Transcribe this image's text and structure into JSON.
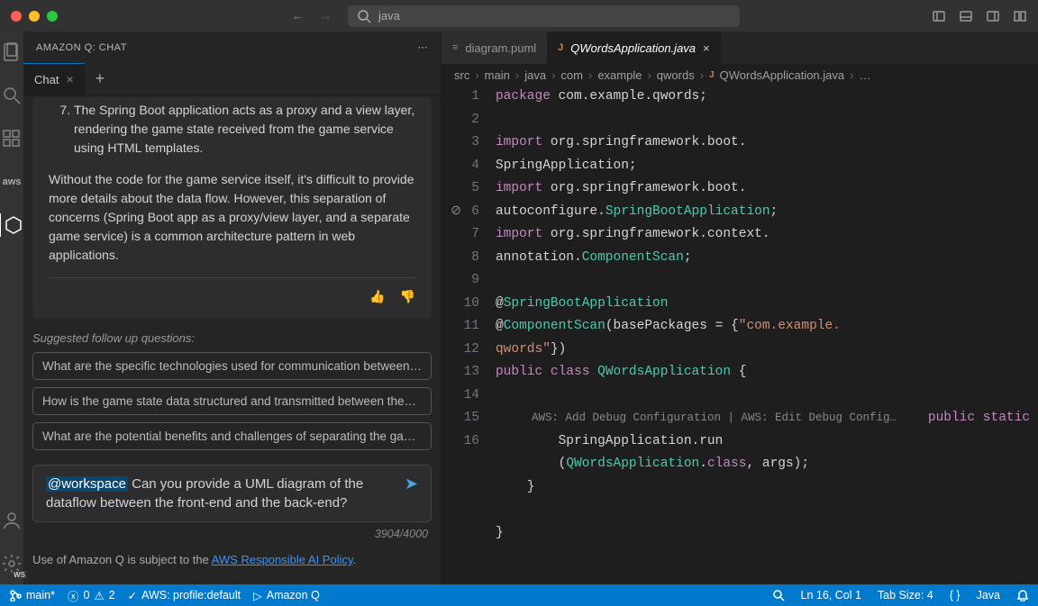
{
  "titlebar": {
    "search_value": "java"
  },
  "chat": {
    "header": "AMAZON Q: CHAT",
    "tab_label": "Chat",
    "list_item_num": "7.",
    "list_item_text": "The Spring Boot application acts as a proxy and a view layer, rendering the game state received from the game service using HTML templates.",
    "paragraph": "Without the code for the game service itself, it's difficult to provide more details about the data flow. However, this separation of concerns (Spring Boot app as a proxy/view layer, and a separate game service) is a common architecture pattern in web applications.",
    "suggested_label": "Suggested follow up questions:",
    "suggestions": [
      "What are the specific technologies used for communication between…",
      "How is the game state data structured and transmitted between the…",
      "What are the potential benefits and challenges of separating the ga…"
    ],
    "input_mention": "@workspace",
    "input_rest": " Can you provide a UML diagram of the dataflow between the front-end and the back-end?",
    "char_count": "3904/4000",
    "policy_prefix": "Use of Amazon Q is subject to the ",
    "policy_link": "AWS Responsible AI Policy",
    "policy_suffix": "."
  },
  "editor": {
    "tabs": [
      {
        "icon": "≡",
        "name": "diagram.puml",
        "active": false
      },
      {
        "icon": "J",
        "name": "QWordsApplication.java",
        "active": true
      }
    ],
    "breadcrumbs": [
      "src",
      "main",
      "java",
      "com",
      "example",
      "qwords"
    ],
    "breadcrumb_file": "QWordsApplication.java",
    "breadcrumb_more": "…",
    "codelens": "AWS: Add Debug Configuration | AWS: Edit Debug Config…"
  },
  "statusbar": {
    "branch": "main*",
    "errors": "0",
    "warnings": "2",
    "profile": "AWS: profile:default",
    "amazonq": "Amazon Q",
    "cursor": "Ln 16, Col 1",
    "tabsize": "Tab Size: 4",
    "braces": "{ }",
    "lang": "Java"
  },
  "chart_data": null
}
